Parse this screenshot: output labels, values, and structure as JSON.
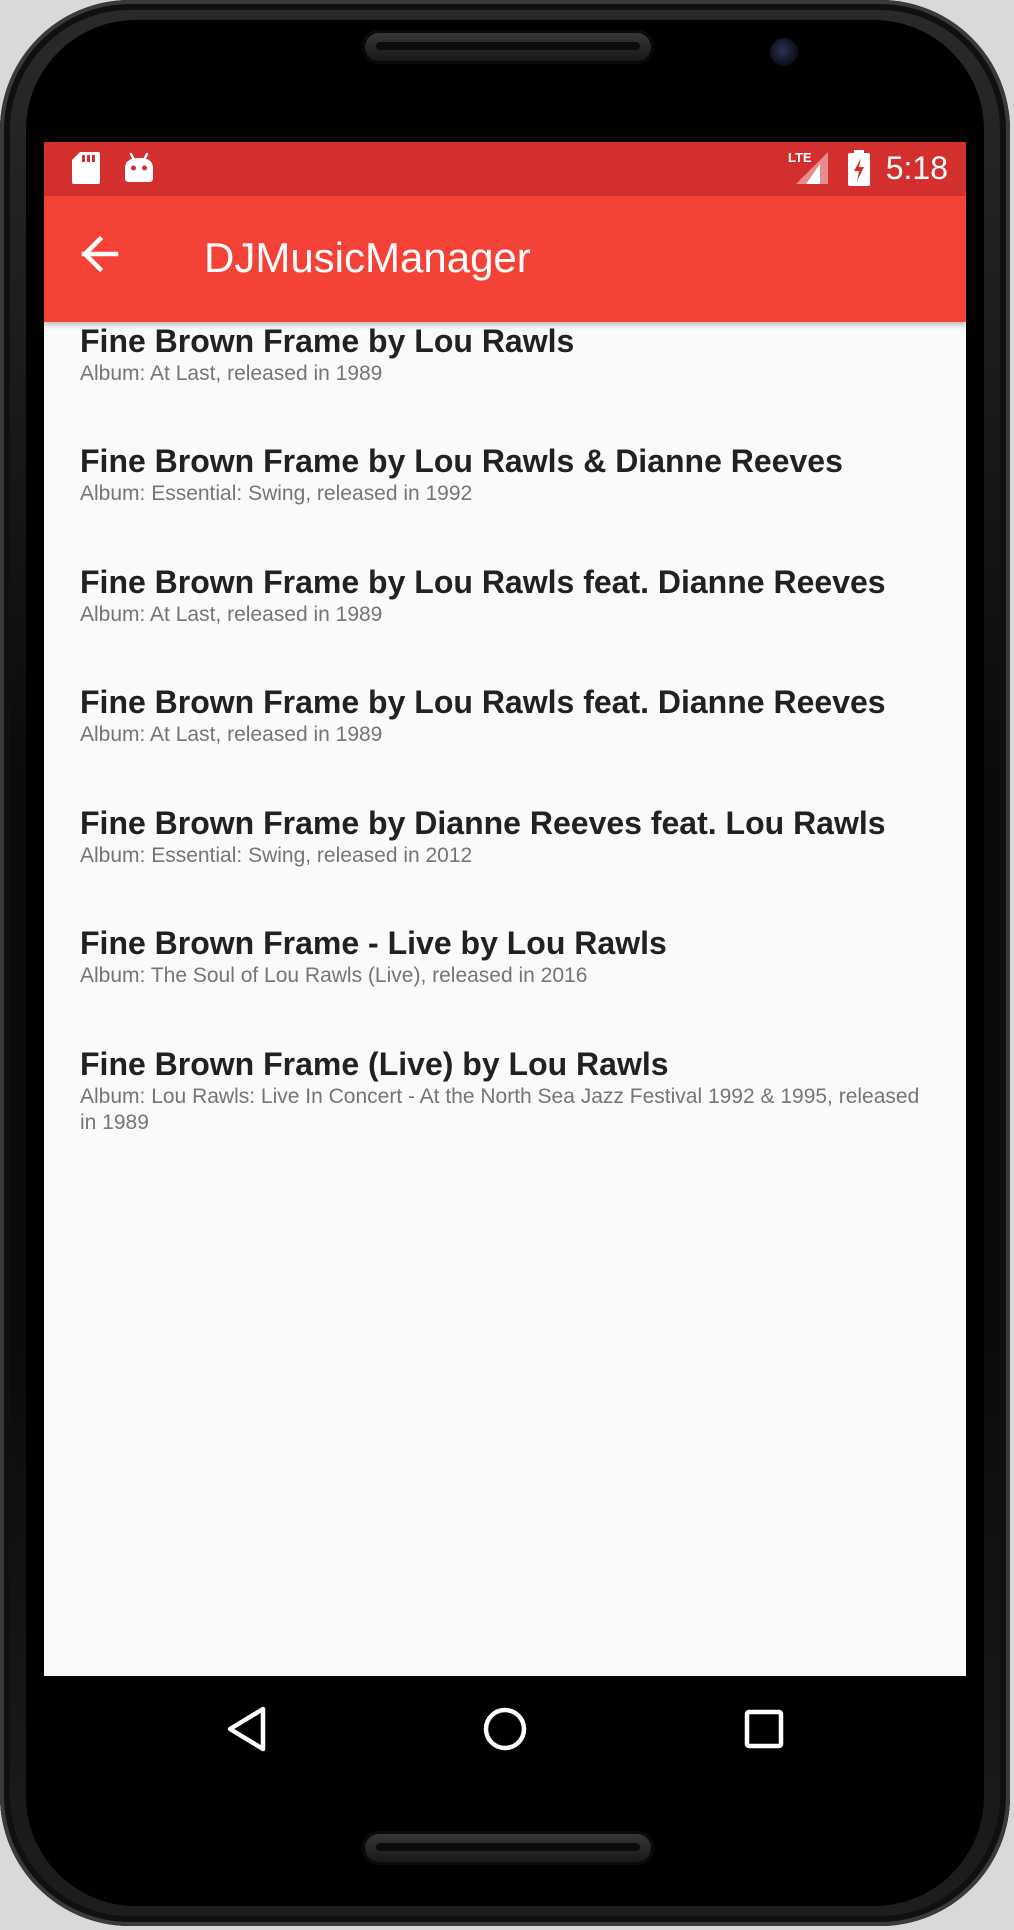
{
  "status_bar": {
    "time": "5:18",
    "network_label": "LTE",
    "icons": [
      "sd-card-icon",
      "android-icon",
      "lte-signal-icon",
      "battery-charging-icon"
    ]
  },
  "app_bar": {
    "title": "DJMusicManager",
    "back_icon": "arrow-back-icon"
  },
  "tracks": [
    {
      "title": "Fine Brown Frame by Lou Rawls",
      "subtitle": "Album: At Last, released in 1989"
    },
    {
      "title": "Fine Brown Frame by Lou Rawls & Dianne Reeves",
      "subtitle": "Album: Essential: Swing, released in 1992"
    },
    {
      "title": "Fine Brown Frame by Lou Rawls feat. Dianne Reeves",
      "subtitle": "Album: At Last, released in 1989"
    },
    {
      "title": "Fine Brown Frame by Lou Rawls feat. Dianne Reeves",
      "subtitle": "Album: At Last, released in 1989"
    },
    {
      "title": "Fine Brown Frame by Dianne Reeves feat. Lou Rawls",
      "subtitle": "Album: Essential: Swing, released in 2012"
    },
    {
      "title": "Fine Brown Frame - Live by Lou Rawls",
      "subtitle": "Album: The Soul of Lou Rawls (Live), released in 2016"
    },
    {
      "title": "Fine Brown Frame (Live) by Lou Rawls",
      "subtitle": "Album: Lou Rawls: Live In Concert - At the North Sea Jazz Festival 1992 & 1995, released in 1989"
    }
  ],
  "nav_bar": {
    "icons": [
      "back-triangle-icon",
      "home-circle-icon",
      "recents-square-icon"
    ]
  },
  "colors": {
    "status_bar": "#d32f2f",
    "app_bar": "#f44336",
    "background": "#fafafa",
    "title_text": "#212121",
    "subtitle_text": "#757575"
  }
}
